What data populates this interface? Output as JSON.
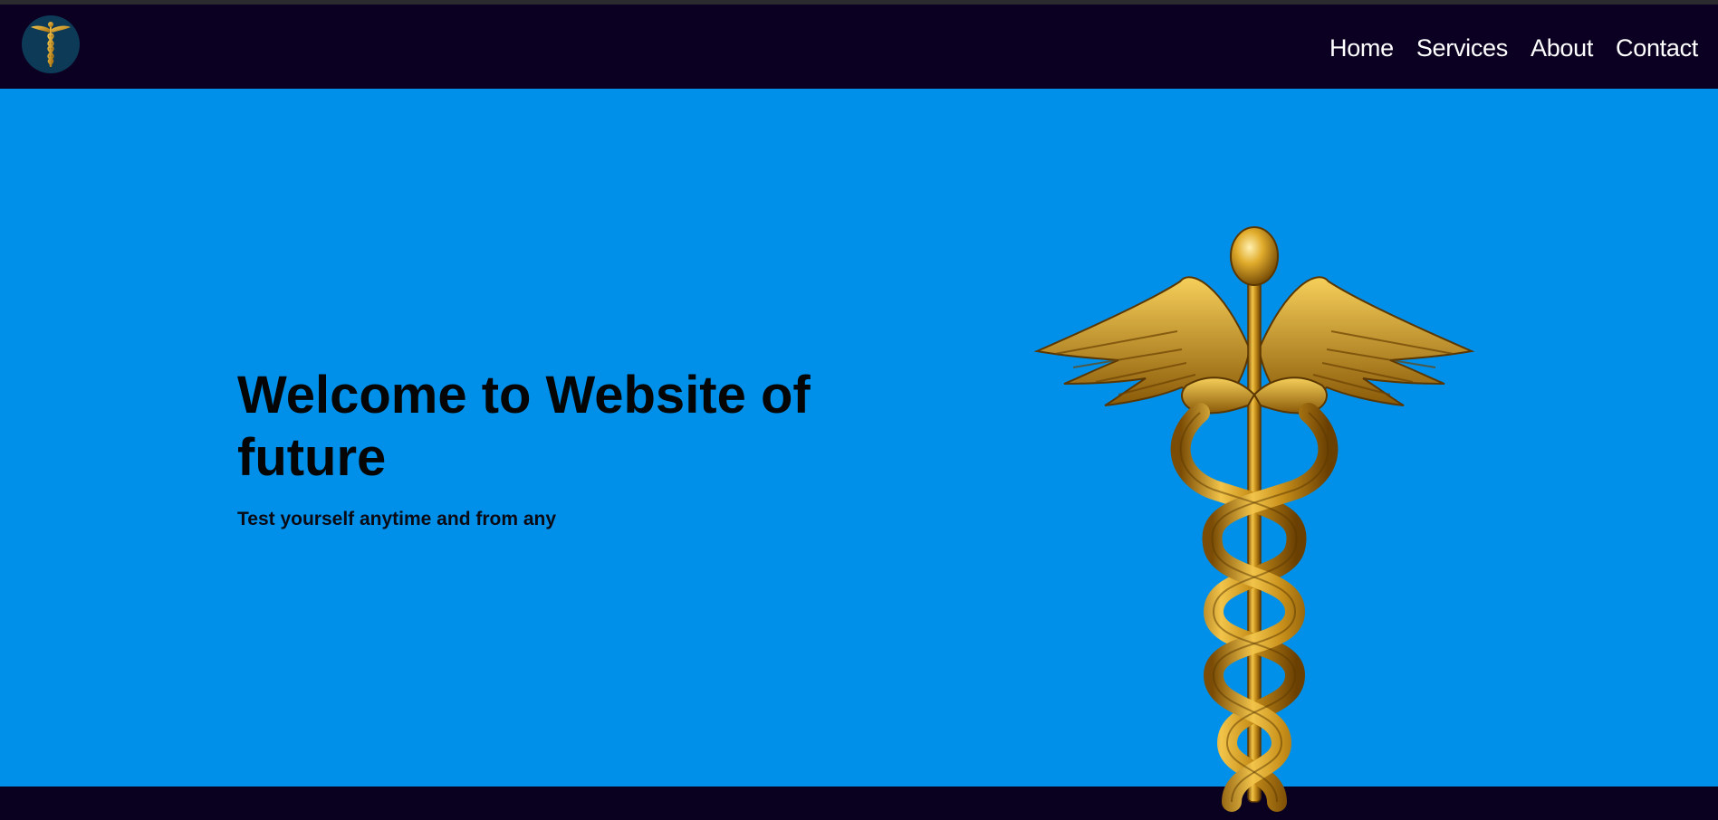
{
  "nav": {
    "logo_icon": "caduceus-logo",
    "links": [
      {
        "label": "Home"
      },
      {
        "label": "Services"
      },
      {
        "label": "About"
      },
      {
        "label": "Contact"
      }
    ]
  },
  "hero": {
    "title": "Welcome to Website of future",
    "subtitle": "Test yourself anytime and from any",
    "image_icon": "caduceus-image"
  },
  "colors": {
    "navbar": "#0b0021",
    "hero_background": "#0090ea",
    "nav_text": "#ffffff",
    "gold": "#c8951c"
  }
}
